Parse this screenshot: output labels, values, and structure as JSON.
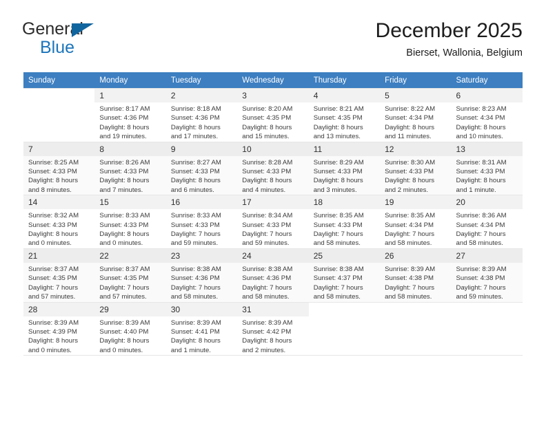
{
  "logo": {
    "line1": "General",
    "line2": "Blue",
    "triangle_color": "#11659e",
    "blue_color": "#1b75bb"
  },
  "header": {
    "title": "December 2025",
    "subtitle": "Bierset, Wallonia, Belgium"
  },
  "theme": {
    "header_row_bg": "#3d7fc1",
    "header_row_text": "#ffffff",
    "daynum_bg": "#f2f2f2",
    "alt_row_bg": "#fafafa"
  },
  "calendar": {
    "weekday_headers": [
      "Sunday",
      "Monday",
      "Tuesday",
      "Wednesday",
      "Thursday",
      "Friday",
      "Saturday"
    ],
    "weeks": [
      [
        {
          "day": "",
          "sunrise": "",
          "sunset": "",
          "daylight1": "",
          "daylight2": ""
        },
        {
          "day": "1",
          "sunrise": "Sunrise: 8:17 AM",
          "sunset": "Sunset: 4:36 PM",
          "daylight1": "Daylight: 8 hours",
          "daylight2": "and 19 minutes."
        },
        {
          "day": "2",
          "sunrise": "Sunrise: 8:18 AM",
          "sunset": "Sunset: 4:36 PM",
          "daylight1": "Daylight: 8 hours",
          "daylight2": "and 17 minutes."
        },
        {
          "day": "3",
          "sunrise": "Sunrise: 8:20 AM",
          "sunset": "Sunset: 4:35 PM",
          "daylight1": "Daylight: 8 hours",
          "daylight2": "and 15 minutes."
        },
        {
          "day": "4",
          "sunrise": "Sunrise: 8:21 AM",
          "sunset": "Sunset: 4:35 PM",
          "daylight1": "Daylight: 8 hours",
          "daylight2": "and 13 minutes."
        },
        {
          "day": "5",
          "sunrise": "Sunrise: 8:22 AM",
          "sunset": "Sunset: 4:34 PM",
          "daylight1": "Daylight: 8 hours",
          "daylight2": "and 11 minutes."
        },
        {
          "day": "6",
          "sunrise": "Sunrise: 8:23 AM",
          "sunset": "Sunset: 4:34 PM",
          "daylight1": "Daylight: 8 hours",
          "daylight2": "and 10 minutes."
        }
      ],
      [
        {
          "day": "7",
          "sunrise": "Sunrise: 8:25 AM",
          "sunset": "Sunset: 4:33 PM",
          "daylight1": "Daylight: 8 hours",
          "daylight2": "and 8 minutes."
        },
        {
          "day": "8",
          "sunrise": "Sunrise: 8:26 AM",
          "sunset": "Sunset: 4:33 PM",
          "daylight1": "Daylight: 8 hours",
          "daylight2": "and 7 minutes."
        },
        {
          "day": "9",
          "sunrise": "Sunrise: 8:27 AM",
          "sunset": "Sunset: 4:33 PM",
          "daylight1": "Daylight: 8 hours",
          "daylight2": "and 6 minutes."
        },
        {
          "day": "10",
          "sunrise": "Sunrise: 8:28 AM",
          "sunset": "Sunset: 4:33 PM",
          "daylight1": "Daylight: 8 hours",
          "daylight2": "and 4 minutes."
        },
        {
          "day": "11",
          "sunrise": "Sunrise: 8:29 AM",
          "sunset": "Sunset: 4:33 PM",
          "daylight1": "Daylight: 8 hours",
          "daylight2": "and 3 minutes."
        },
        {
          "day": "12",
          "sunrise": "Sunrise: 8:30 AM",
          "sunset": "Sunset: 4:33 PM",
          "daylight1": "Daylight: 8 hours",
          "daylight2": "and 2 minutes."
        },
        {
          "day": "13",
          "sunrise": "Sunrise: 8:31 AM",
          "sunset": "Sunset: 4:33 PM",
          "daylight1": "Daylight: 8 hours",
          "daylight2": "and 1 minute."
        }
      ],
      [
        {
          "day": "14",
          "sunrise": "Sunrise: 8:32 AM",
          "sunset": "Sunset: 4:33 PM",
          "daylight1": "Daylight: 8 hours",
          "daylight2": "and 0 minutes."
        },
        {
          "day": "15",
          "sunrise": "Sunrise: 8:33 AM",
          "sunset": "Sunset: 4:33 PM",
          "daylight1": "Daylight: 8 hours",
          "daylight2": "and 0 minutes."
        },
        {
          "day": "16",
          "sunrise": "Sunrise: 8:33 AM",
          "sunset": "Sunset: 4:33 PM",
          "daylight1": "Daylight: 7 hours",
          "daylight2": "and 59 minutes."
        },
        {
          "day": "17",
          "sunrise": "Sunrise: 8:34 AM",
          "sunset": "Sunset: 4:33 PM",
          "daylight1": "Daylight: 7 hours",
          "daylight2": "and 59 minutes."
        },
        {
          "day": "18",
          "sunrise": "Sunrise: 8:35 AM",
          "sunset": "Sunset: 4:33 PM",
          "daylight1": "Daylight: 7 hours",
          "daylight2": "and 58 minutes."
        },
        {
          "day": "19",
          "sunrise": "Sunrise: 8:35 AM",
          "sunset": "Sunset: 4:34 PM",
          "daylight1": "Daylight: 7 hours",
          "daylight2": "and 58 minutes."
        },
        {
          "day": "20",
          "sunrise": "Sunrise: 8:36 AM",
          "sunset": "Sunset: 4:34 PM",
          "daylight1": "Daylight: 7 hours",
          "daylight2": "and 58 minutes."
        }
      ],
      [
        {
          "day": "21",
          "sunrise": "Sunrise: 8:37 AM",
          "sunset": "Sunset: 4:35 PM",
          "daylight1": "Daylight: 7 hours",
          "daylight2": "and 57 minutes."
        },
        {
          "day": "22",
          "sunrise": "Sunrise: 8:37 AM",
          "sunset": "Sunset: 4:35 PM",
          "daylight1": "Daylight: 7 hours",
          "daylight2": "and 57 minutes."
        },
        {
          "day": "23",
          "sunrise": "Sunrise: 8:38 AM",
          "sunset": "Sunset: 4:36 PM",
          "daylight1": "Daylight: 7 hours",
          "daylight2": "and 58 minutes."
        },
        {
          "day": "24",
          "sunrise": "Sunrise: 8:38 AM",
          "sunset": "Sunset: 4:36 PM",
          "daylight1": "Daylight: 7 hours",
          "daylight2": "and 58 minutes."
        },
        {
          "day": "25",
          "sunrise": "Sunrise: 8:38 AM",
          "sunset": "Sunset: 4:37 PM",
          "daylight1": "Daylight: 7 hours",
          "daylight2": "and 58 minutes."
        },
        {
          "day": "26",
          "sunrise": "Sunrise: 8:39 AM",
          "sunset": "Sunset: 4:38 PM",
          "daylight1": "Daylight: 7 hours",
          "daylight2": "and 58 minutes."
        },
        {
          "day": "27",
          "sunrise": "Sunrise: 8:39 AM",
          "sunset": "Sunset: 4:38 PM",
          "daylight1": "Daylight: 7 hours",
          "daylight2": "and 59 minutes."
        }
      ],
      [
        {
          "day": "28",
          "sunrise": "Sunrise: 8:39 AM",
          "sunset": "Sunset: 4:39 PM",
          "daylight1": "Daylight: 8 hours",
          "daylight2": "and 0 minutes."
        },
        {
          "day": "29",
          "sunrise": "Sunrise: 8:39 AM",
          "sunset": "Sunset: 4:40 PM",
          "daylight1": "Daylight: 8 hours",
          "daylight2": "and 0 minutes."
        },
        {
          "day": "30",
          "sunrise": "Sunrise: 8:39 AM",
          "sunset": "Sunset: 4:41 PM",
          "daylight1": "Daylight: 8 hours",
          "daylight2": "and 1 minute."
        },
        {
          "day": "31",
          "sunrise": "Sunrise: 8:39 AM",
          "sunset": "Sunset: 4:42 PM",
          "daylight1": "Daylight: 8 hours",
          "daylight2": "and 2 minutes."
        },
        {
          "day": "",
          "sunrise": "",
          "sunset": "",
          "daylight1": "",
          "daylight2": ""
        },
        {
          "day": "",
          "sunrise": "",
          "sunset": "",
          "daylight1": "",
          "daylight2": ""
        },
        {
          "day": "",
          "sunrise": "",
          "sunset": "",
          "daylight1": "",
          "daylight2": ""
        }
      ]
    ]
  }
}
